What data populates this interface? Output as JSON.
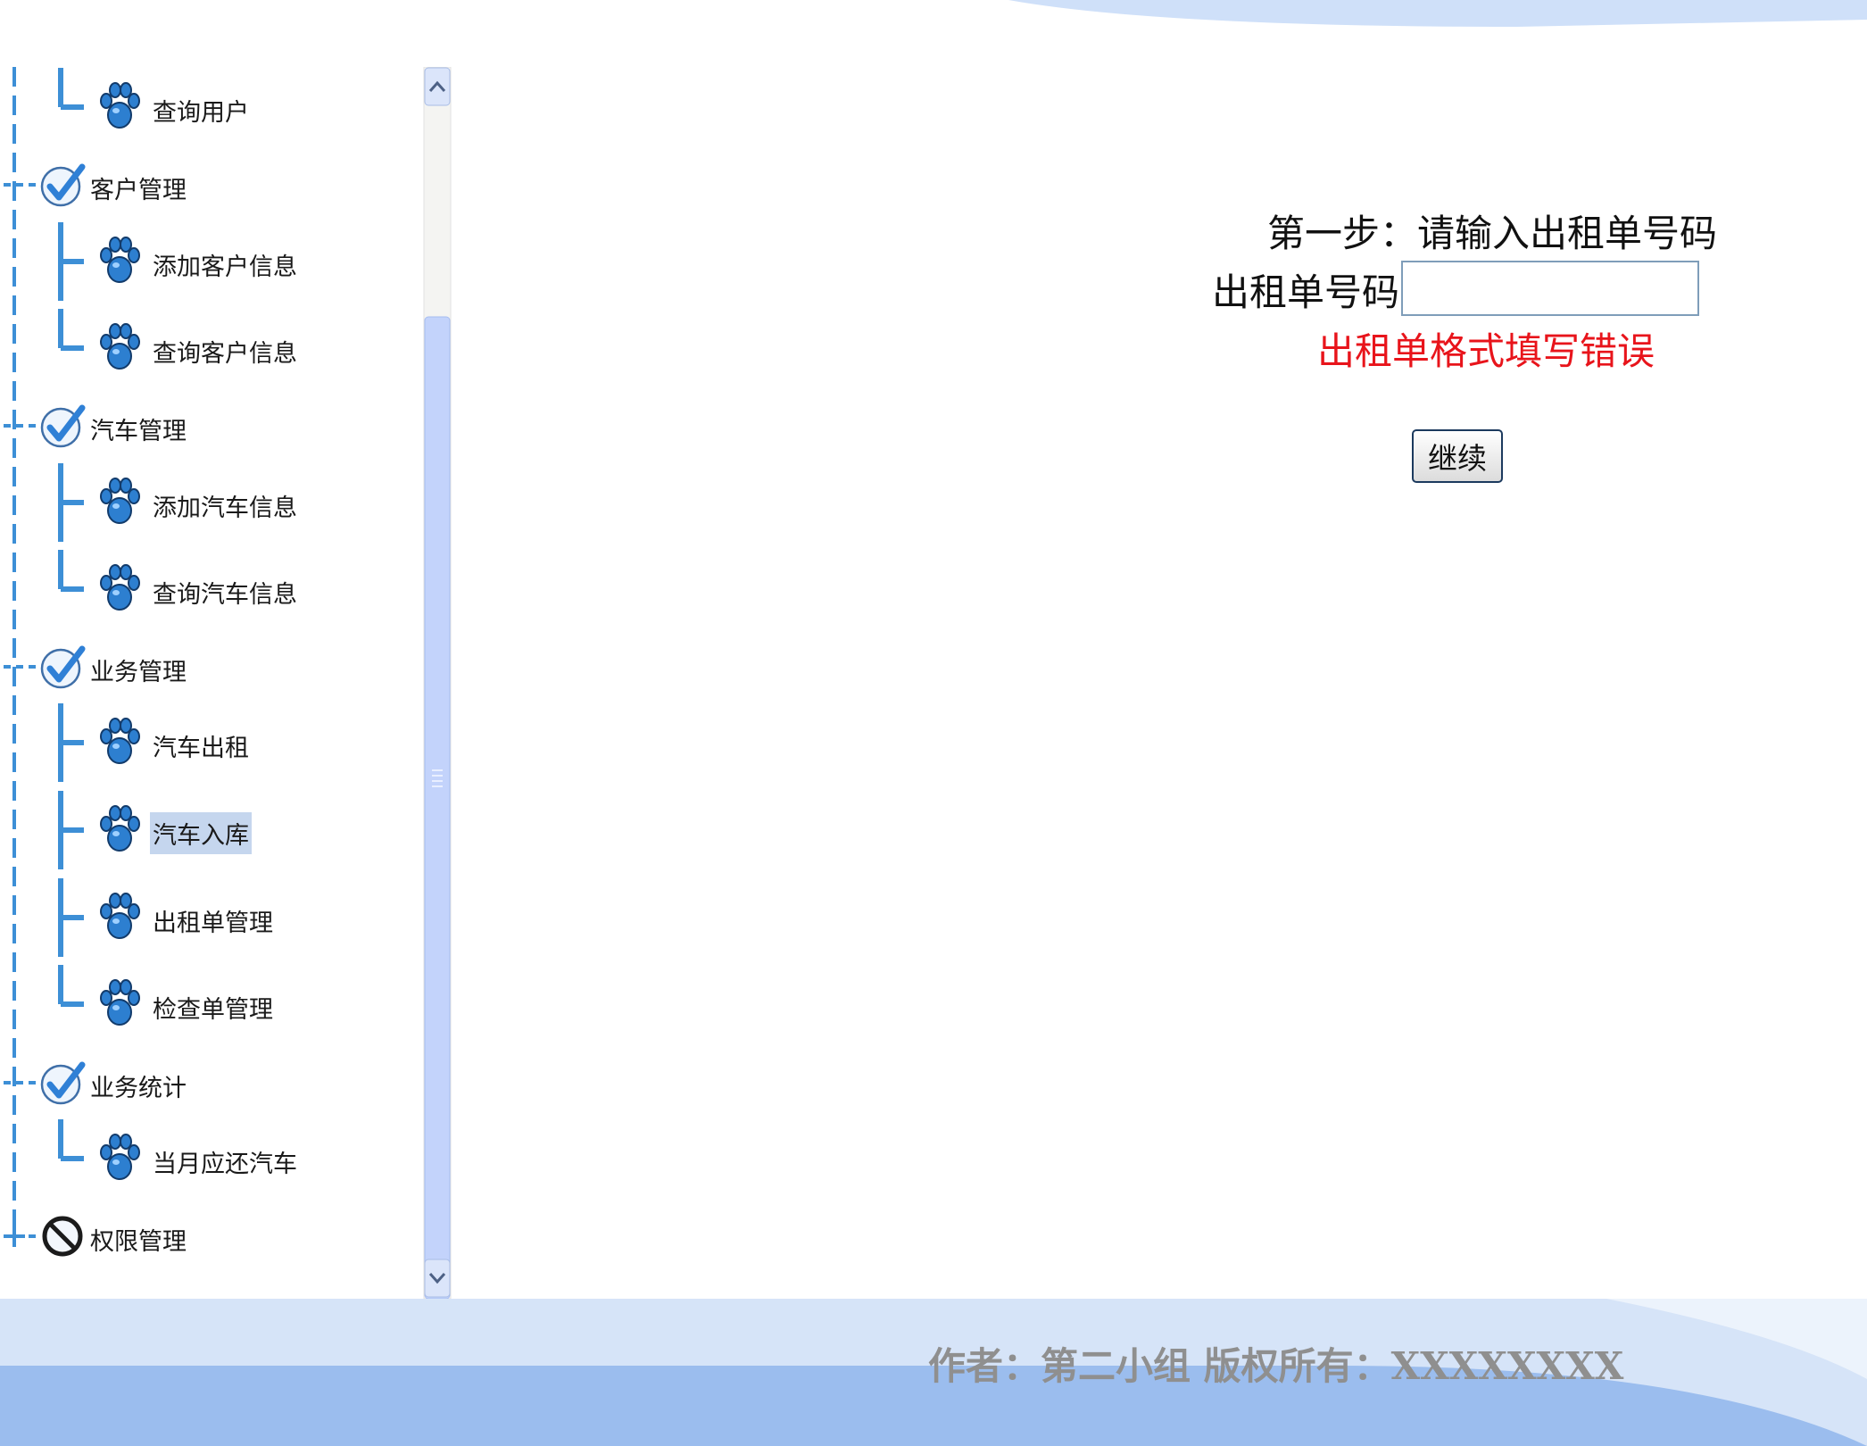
{
  "sidebar": {
    "tree": [
      {
        "label": "查询用户",
        "level": 2,
        "icon": "paw-icon",
        "connector": "last"
      },
      {
        "label": "客户管理",
        "level": 1,
        "icon": "check-icon"
      },
      {
        "label": "添加客户信息",
        "level": 2,
        "icon": "paw-icon",
        "connector": "mid"
      },
      {
        "label": "查询客户信息",
        "level": 2,
        "icon": "paw-icon",
        "connector": "last"
      },
      {
        "label": "汽车管理",
        "level": 1,
        "icon": "check-icon"
      },
      {
        "label": "添加汽车信息",
        "level": 2,
        "icon": "paw-icon",
        "connector": "mid"
      },
      {
        "label": "查询汽车信息",
        "level": 2,
        "icon": "paw-icon",
        "connector": "last"
      },
      {
        "label": "业务管理",
        "level": 1,
        "icon": "check-icon"
      },
      {
        "label": "汽车出租",
        "level": 2,
        "icon": "paw-icon",
        "connector": "mid"
      },
      {
        "label": "汽车入库",
        "level": 2,
        "icon": "paw-icon",
        "connector": "mid",
        "selected": true
      },
      {
        "label": "出租单管理",
        "level": 2,
        "icon": "paw-icon",
        "connector": "mid"
      },
      {
        "label": "检查单管理",
        "level": 2,
        "icon": "paw-icon",
        "connector": "last"
      },
      {
        "label": "业务统计",
        "level": 1,
        "icon": "check-icon"
      },
      {
        "label": "当月应还汽车",
        "level": 2,
        "icon": "paw-icon",
        "connector": "last"
      },
      {
        "label": "权限管理",
        "level": 1,
        "icon": "forbidden-icon"
      }
    ]
  },
  "main": {
    "step_title": "第一步：请输入出租单号码",
    "field_label": "出租单号码：",
    "order_input": {
      "value": "",
      "placeholder": ""
    },
    "error_message": "出租单格式填写错误",
    "continue_label": "继续"
  },
  "footer": {
    "copyright": "作者：第二小组 版权所有：XXXXXXXX"
  },
  "colors": {
    "tree_line": "#3d8fd6",
    "error": "#e8141b",
    "selected_bg": "#c5d6ee",
    "footer_light": "#d6e4f8",
    "footer_dark": "#9bbdee"
  }
}
